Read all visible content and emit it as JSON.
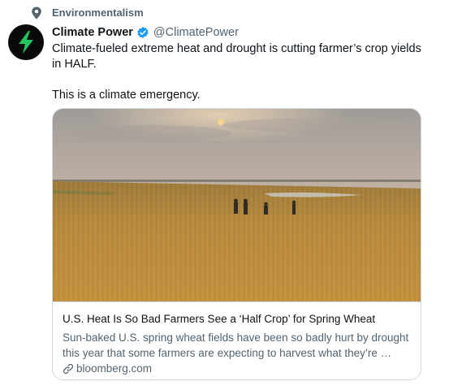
{
  "social_context": {
    "label": "Environmentalism",
    "icon": "location-pin-icon"
  },
  "author": {
    "name": "Climate Power",
    "handle": "@ClimatePower",
    "verified": true,
    "avatar_icon": "lightning-bolt-icon",
    "avatar_colors": {
      "background": "#0a0a0a",
      "bolt": "#22c55e"
    }
  },
  "tweet": {
    "paragraphs": [
      "Climate-fueled extreme heat and drought is cutting farmer’s crop yields in HALF.",
      "This is a climate emergency."
    ]
  },
  "card": {
    "title": "U.S. Heat Is So Bad Farmers See a ‘Half Crop’ for Spring Wheat",
    "description": "Sun-baked U.S. spring wheat fields have been so badly hurt by drought this year that some farmers are expecting to harvest what they’re …",
    "domain": "bloomberg.com",
    "domain_icon": "link-icon",
    "image_subject": "wheat-field-photo"
  },
  "colors": {
    "text_primary": "#0f1419",
    "text_secondary": "#536471",
    "verified_blue": "#1d9bf0",
    "border": "#cfd9de"
  }
}
